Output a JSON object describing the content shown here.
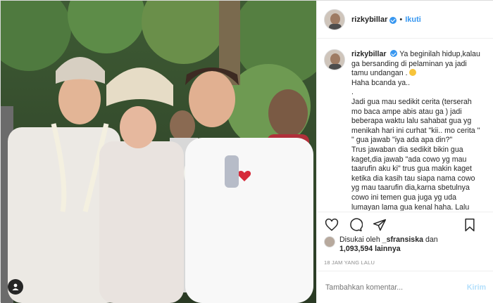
{
  "post": {
    "username": "rizkybillar",
    "separator": "•",
    "follow_label": "Ikuti",
    "caption_lines": [
      "Ya beginilah hidup,kalau",
      "ga bersanding di pelaminan ya jadi",
      "tamu undangan .",
      "Haha bcanda ya..",
      ".",
      "Jadi gua mau sedikit cerita (terserah",
      "mo baca ampe abis atau ga ) jadi",
      "beberapa waktu lalu sahabat gua yg",
      "menikah hari ini curhat \"kii.. mo cerita \"",
      "\" gua jawab \"iya ada apa din?\"",
      "Trus jawaban dia sedikit bikin gua",
      "kaget,dia jawab \"ada cowo yg mau",
      "taarufin aku ki\" trus gua makin kaget",
      "ketika dia kasih tau siapa nama cowo",
      "yg mau taarufin dia,karna sbetulnya",
      "cowo ini temen gua juga yg uda",
      "lumayan lama gua kenal haha. Lalu"
    ],
    "liked_by_prefix": "Disukai oleh",
    "liked_by_user": "_sfransiska",
    "liked_by_and": "dan",
    "likes_count": "1,093,594",
    "likes_suffix": "lainnya",
    "time_ago": "18 JAM YANG LALU",
    "comment_placeholder": "Tambahkan komentar...",
    "send_label": "Kirim"
  },
  "colors": {
    "accent": "#3897f0",
    "send_disabled": "#b2dffc",
    "muted": "#8e8e8e",
    "border": "#dbdbdb"
  },
  "icons": [
    "heart-icon",
    "comment-icon",
    "share-icon",
    "save-icon",
    "verified-icon",
    "user-tag-icon",
    "laugh-emoji-icon"
  ]
}
